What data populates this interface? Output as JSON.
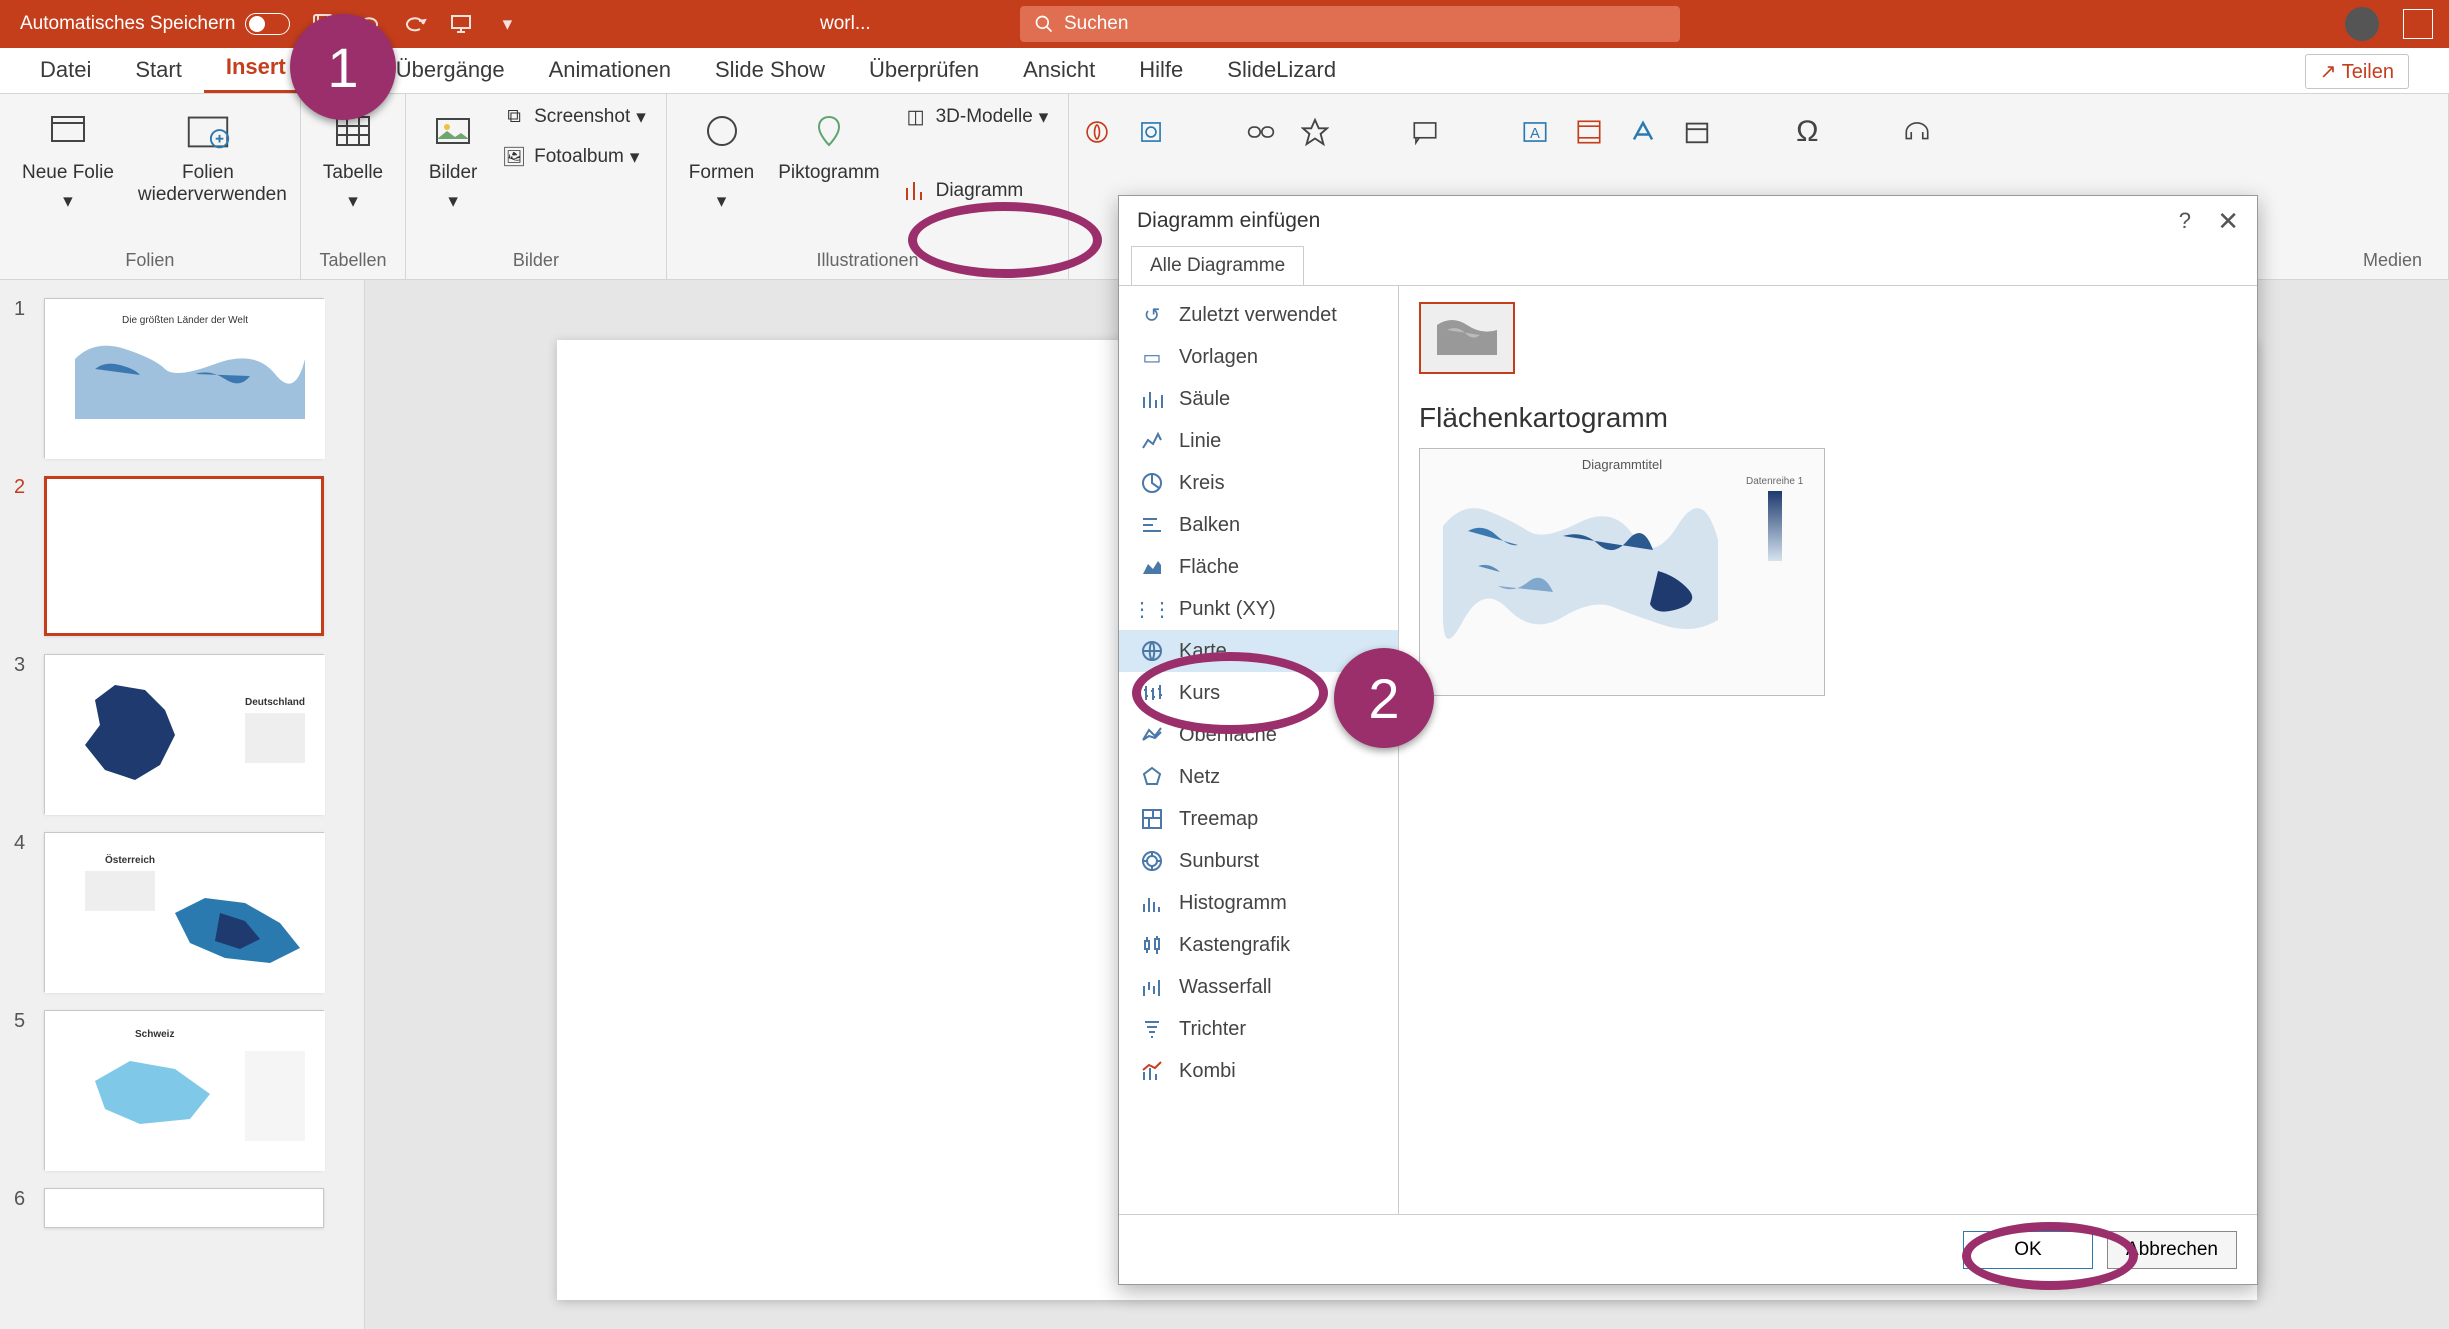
{
  "titlebar": {
    "autosave": "Automatisches Speichern",
    "doc": "worl...",
    "search_placeholder": "Suchen"
  },
  "tabs": {
    "datei": "Datei",
    "start": "Start",
    "insert": "Insert",
    "uebergaenge": "Übergänge",
    "animationen": "Animationen",
    "slideshow": "Slide Show",
    "ueberpruefen": "Überprüfen",
    "ansicht": "Ansicht",
    "hilfe": "Hilfe",
    "slidelizard": "SlideLizard",
    "share": "Teilen"
  },
  "ribbon": {
    "folien": {
      "neue_folie": "Neue Folie",
      "wiederverwenden": "Folien wiederverwenden",
      "label": "Folien"
    },
    "tabellen": {
      "tabelle": "Tabelle",
      "label": "Tabellen"
    },
    "bilder": {
      "bilder": "Bilder",
      "screenshot": "Screenshot",
      "fotoalbum": "Fotoalbum",
      "label": "Bilder"
    },
    "illustr": {
      "formen": "Formen",
      "piktogramm": "Piktogramm",
      "models": "3D-Modelle",
      "diagramm": "Diagramm",
      "label": "Illustrationen"
    },
    "medien": "Medien"
  },
  "dialog": {
    "title": "Diagramm einfügen",
    "tab": "Alle Diagramme",
    "items": {
      "zuletzt": "Zuletzt verwendet",
      "vorlagen": "Vorlagen",
      "saeule": "Säule",
      "linie": "Linie",
      "kreis": "Kreis",
      "balken": "Balken",
      "flaeche": "Fläche",
      "punkt": "Punkt (XY)",
      "karte": "Karte",
      "kurs": "Kurs",
      "oberflaeche": "Oberfläche",
      "netz": "Netz",
      "treemap": "Treemap",
      "sunburst": "Sunburst",
      "histogramm": "Histogramm",
      "kastengrafik": "Kastengrafik",
      "wasserfall": "Wasserfall",
      "trichter": "Trichter",
      "kombi": "Kombi"
    },
    "heading": "Flächenkartogramm",
    "preview_title": "Diagrammtitel",
    "preview_legend": "Datenreihe 1",
    "ok": "OK",
    "cancel": "Abbrechen"
  },
  "annotations": {
    "one": "1",
    "two": "2"
  },
  "slides": [
    "1",
    "2",
    "3",
    "4",
    "5",
    "6"
  ]
}
